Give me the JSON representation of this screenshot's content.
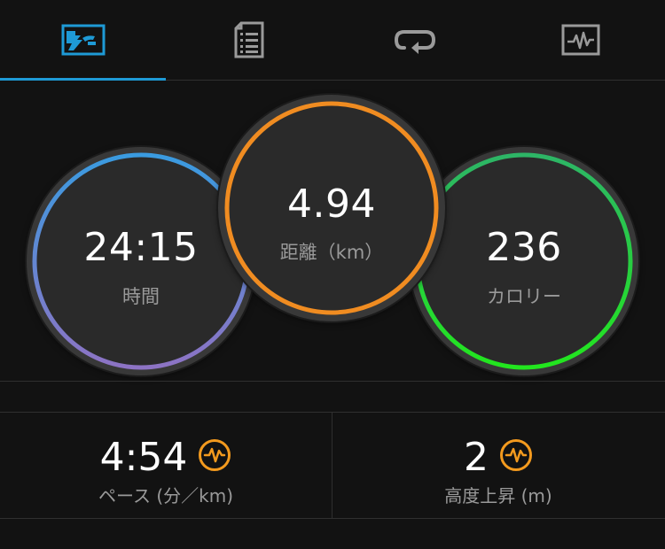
{
  "tabs": [
    {
      "name": "tab-summary",
      "icon": "running-stats-icon",
      "active": true
    },
    {
      "name": "tab-details",
      "icon": "document-list-icon",
      "active": false
    },
    {
      "name": "tab-laps",
      "icon": "loop-arrow-icon",
      "active": false
    },
    {
      "name": "tab-charts",
      "icon": "activity-chart-icon",
      "active": false
    }
  ],
  "colors": {
    "accent": "#1e9ad6",
    "time_ring_top": "#3a9be0",
    "time_ring_bottom": "#8d73c4",
    "distance_ring": "#f08c21",
    "calories_ring_top": "#2db566",
    "calories_ring_bottom": "#22e61e",
    "icon_gray": "#9a9a9a",
    "badge_orange": "#f39a1e"
  },
  "stats": {
    "time": {
      "value": "24:15",
      "label": "時間"
    },
    "distance": {
      "value": "4.94",
      "label": "距離（km）"
    },
    "calories": {
      "value": "236",
      "label": "カロリー"
    }
  },
  "metrics": {
    "pace": {
      "value": "4:54",
      "label": "ペース (分／km)",
      "icon": "heart-pulse-badge-icon"
    },
    "elevation": {
      "value": "2",
      "label": "高度上昇 (m)",
      "icon": "heart-pulse-badge-icon"
    }
  }
}
